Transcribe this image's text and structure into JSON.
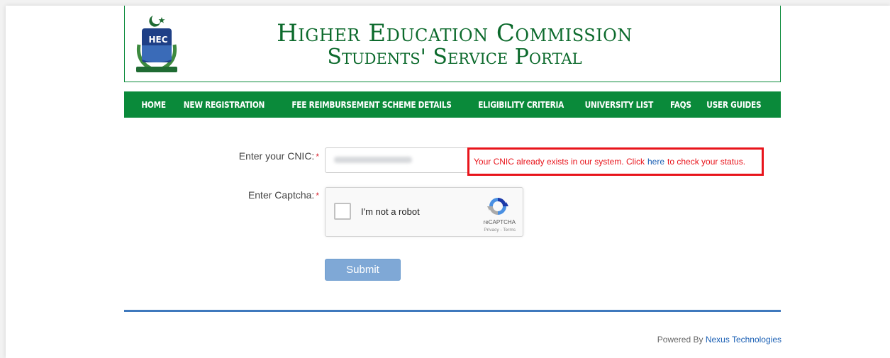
{
  "header": {
    "title_line1": "Higher Education Commission",
    "title_line2": "Students' Service Portal",
    "logo_text": "HEC"
  },
  "nav": {
    "items": [
      {
        "label": "Home"
      },
      {
        "label": "New Registration"
      },
      {
        "label": "Fee Reimbursement Scheme Details"
      },
      {
        "label": "Eligibility Criteria"
      },
      {
        "label": "University List"
      },
      {
        "label": "FAQs"
      },
      {
        "label": "User Guides"
      }
    ]
  },
  "form": {
    "cnic_label": "Enter your CNIC:",
    "captcha_label": "Enter Captcha:",
    "required_mark": "*",
    "cnic_value": "",
    "error_before": "Your CNIC already exists in our system. Click",
    "error_link": "here",
    "error_after": "to check your status.",
    "captcha_text": "I'm not a robot",
    "captcha_brand": "reCAPTCHA",
    "captcha_terms": "Privacy - Terms",
    "submit_label": "Submit"
  },
  "footer": {
    "powered_by": "Powered By",
    "company": "Nexus Technologies"
  },
  "colors": {
    "brand_green": "#0a8a3a",
    "title_green": "#0c6a2c",
    "error_red": "#e8141b",
    "link_blue": "#1a5fb4",
    "divider_blue": "#3f79bd"
  }
}
